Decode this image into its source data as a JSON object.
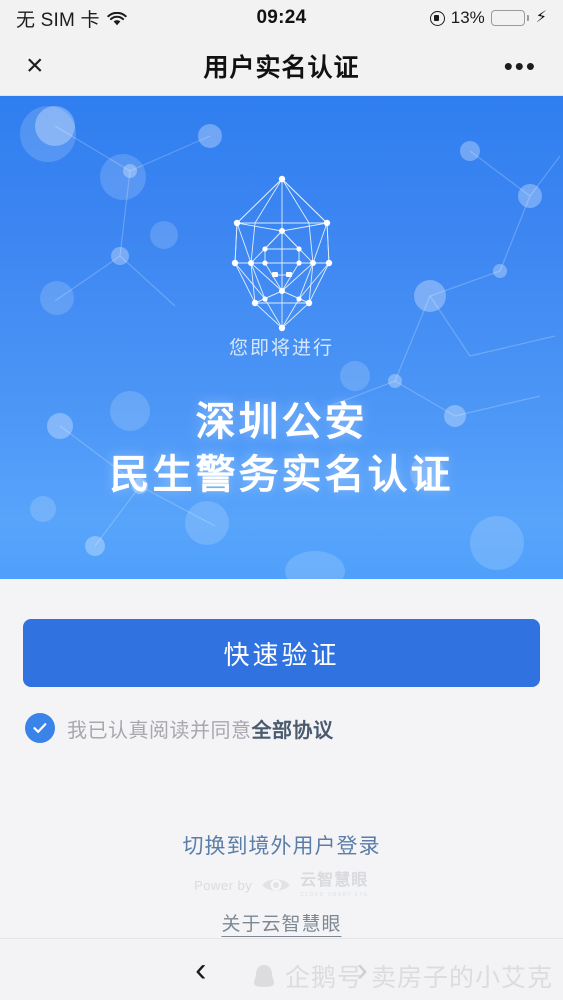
{
  "statusbar": {
    "carrier": "无 SIM 卡",
    "wifi_icon": "wifi-icon",
    "time": "09:24",
    "lock_icon": "rotation-lock-icon",
    "battery_percent": "13%",
    "battery_level": 13,
    "charging_icon": "lightning-bolt-icon",
    "battery_color": "#e8352e"
  },
  "navbar": {
    "close_icon": "×",
    "title": "用户实名认证",
    "more_icon": "•••"
  },
  "hero": {
    "face_scan_icon": "face-scan-mesh-icon",
    "subtitle": "您即将进行",
    "title_line1": "深圳公安",
    "title_line2": "民生警务实名认证",
    "gradient_from": "#2f7ef0",
    "gradient_to": "#58a4fb"
  },
  "main": {
    "primary_button": "快速验证",
    "primary_button_color": "#3072e0",
    "agree_checked": true,
    "agree_text": "我已认真阅读并同意",
    "agree_link": "全部协议"
  },
  "footer": {
    "switch_link": "切换到境外用户登录",
    "power_by_label": "Power by",
    "brand_icon": "eye-logo-icon",
    "brand_name": "云智慧眼",
    "brand_sub": "CLOUD SMART EYE",
    "about_link": "关于云智慧眼"
  },
  "bottombar": {
    "back_icon": "‹",
    "forward_icon": "›",
    "watermark_icon": "penguin-icon",
    "watermark_text": "企鹅号 卖房子的小艾克"
  }
}
